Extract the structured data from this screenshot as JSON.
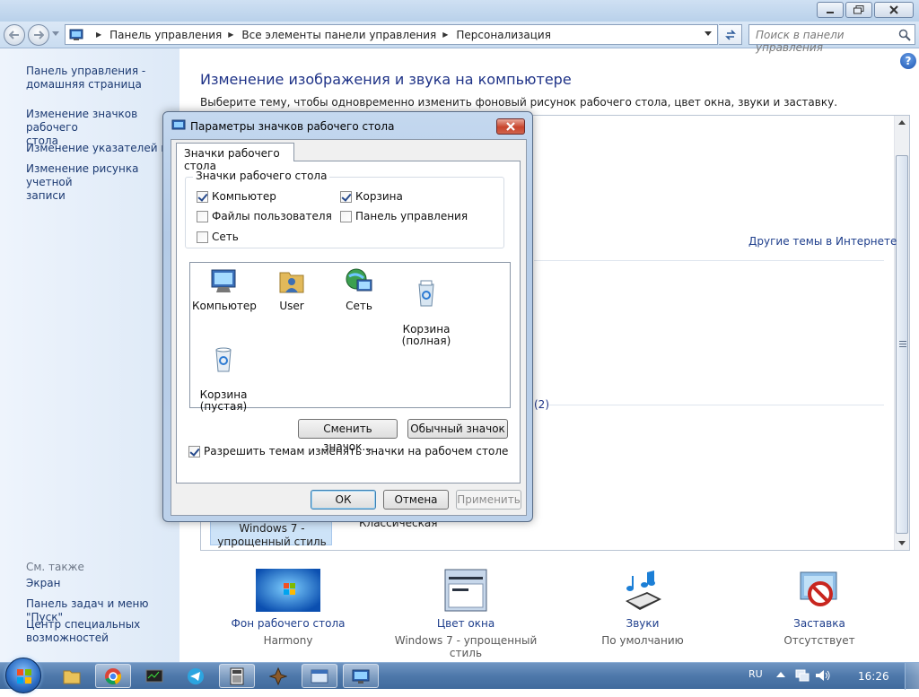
{
  "address": {
    "breadcrumb": [
      "Панель управления",
      "Все элементы панели управления",
      "Персонализация"
    ],
    "search_placeholder": "Поиск в панели управления"
  },
  "sidebar": {
    "links": [
      "Панель управления -\nдомашняя страница",
      "Изменение значков рабочего\nстола",
      "Изменение указателей мыши",
      "Изменение рисунка учетной\nзаписи"
    ],
    "see_also_title": "См. также",
    "see_also": [
      "Экран",
      "Панель задач и меню \"Пуск\"",
      "Центр специальных\nвозможностей"
    ]
  },
  "main": {
    "title": "Изменение изображения и звука на компьютере",
    "description": "Выберите тему, чтобы одновременно изменить фоновый рисунок рабочего стола, цвет окна, звуки и заставку.",
    "other_themes_link": "Другие темы в Интернете",
    "basic_themes_count": "(2)",
    "theme_selected": "Windows 7 -\nупрощенный стиль",
    "theme_classic": "Классическая",
    "bottom_items": [
      {
        "label": "Фон рабочего стола",
        "sub": "Harmony",
        "icon": "wallpaper-icon"
      },
      {
        "label": "Цвет окна",
        "sub": "Windows 7 - упрощенный стиль",
        "icon": "window-color-icon"
      },
      {
        "label": "Звуки",
        "sub": "По умолчанию",
        "icon": "sounds-icon"
      },
      {
        "label": "Заставка",
        "sub": "Отсутствует",
        "icon": "screensaver-icon"
      }
    ]
  },
  "dialog": {
    "title": "Параметры значков рабочего стола",
    "tab": "Значки рабочего стола",
    "group_title": "Значки рабочего стола",
    "checkboxes": [
      {
        "label": "Компьютер",
        "checked": true
      },
      {
        "label": "Корзина",
        "checked": true
      },
      {
        "label": "Файлы пользователя",
        "checked": false
      },
      {
        "label": "Панель управления",
        "checked": false
      },
      {
        "label": "Сеть",
        "checked": false
      }
    ],
    "icons": [
      "Компьютер",
      "User",
      "Сеть",
      "Корзина\n(полная)",
      "Корзина\n(пустая)"
    ],
    "change_icon_button": "Сменить значок...",
    "default_icon_button": "Обычный значок",
    "allow_themes_label": "Разрешить темам изменять значки на рабочем столе",
    "allow_themes_checked": true,
    "ok": "ОК",
    "cancel": "Отмена",
    "apply": "Применить"
  },
  "taskbar": {
    "language": "RU",
    "time": "16:26"
  },
  "colors": {
    "link": "#1e3e8c",
    "title": "#1e3287",
    "sidebar_bg": "#e4eefa",
    "taskbar": "#4e78aa"
  }
}
